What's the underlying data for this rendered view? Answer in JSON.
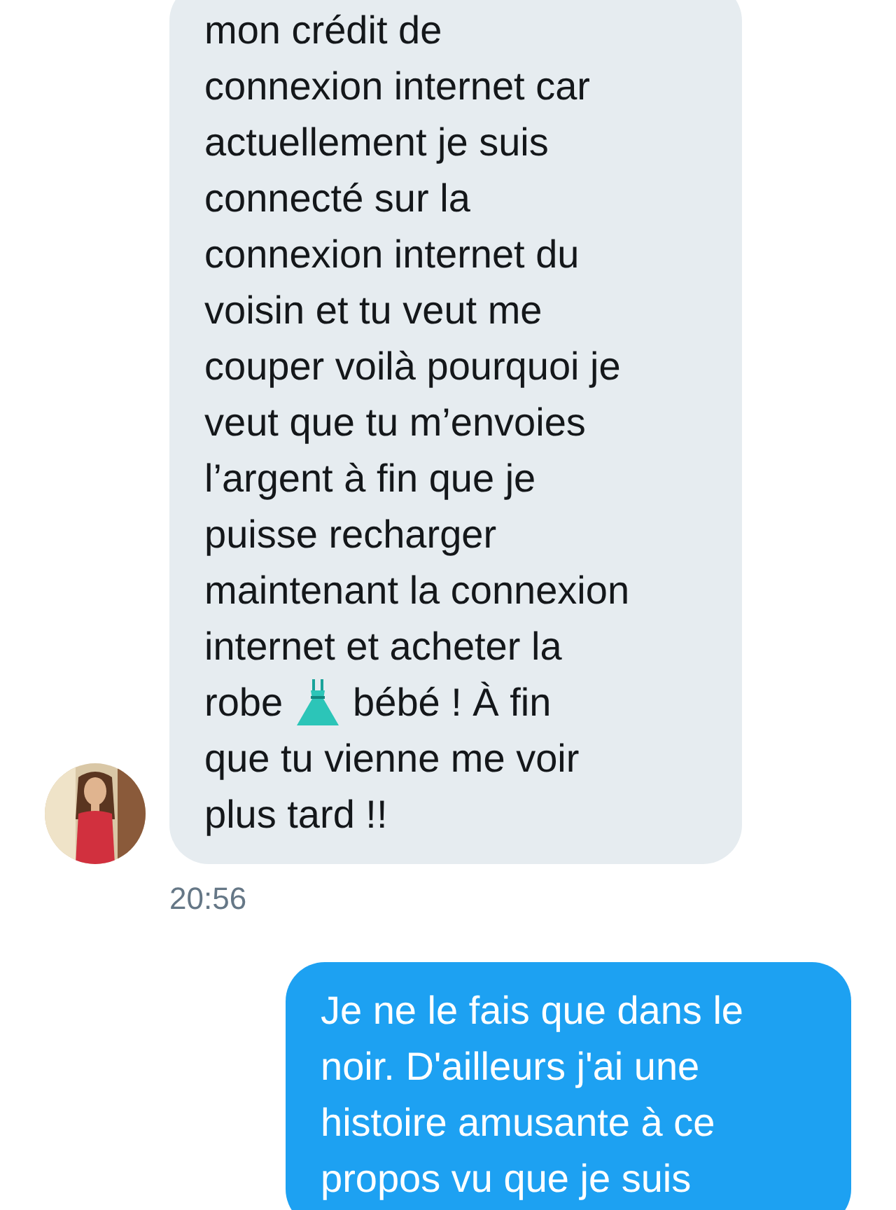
{
  "messages": [
    {
      "sent": false,
      "lines": [
        "mon crédit de",
        "connexion internet car",
        "actuellement je suis",
        "connecté sur la",
        "connexion internet du",
        "voisin et tu veut me",
        "couper voilà pourquoi je",
        "veut que tu m’envoies",
        "l’argent à fin que je",
        "puisse recharger",
        "maintenant la connexion",
        "internet et acheter la"
      ],
      "emoji_line": {
        "before": "robe",
        "after": "bébé ! À fin"
      },
      "lines_after": [
        "que tu vienne me voir",
        "plus tard !!"
      ],
      "time": "20:56"
    },
    {
      "sent": true,
      "lines": [
        "Je ne le fais que dans le",
        "noir. D'ailleurs j'ai une",
        "histoire amusante à ce",
        "propos vu que je suis"
      ]
    }
  ]
}
